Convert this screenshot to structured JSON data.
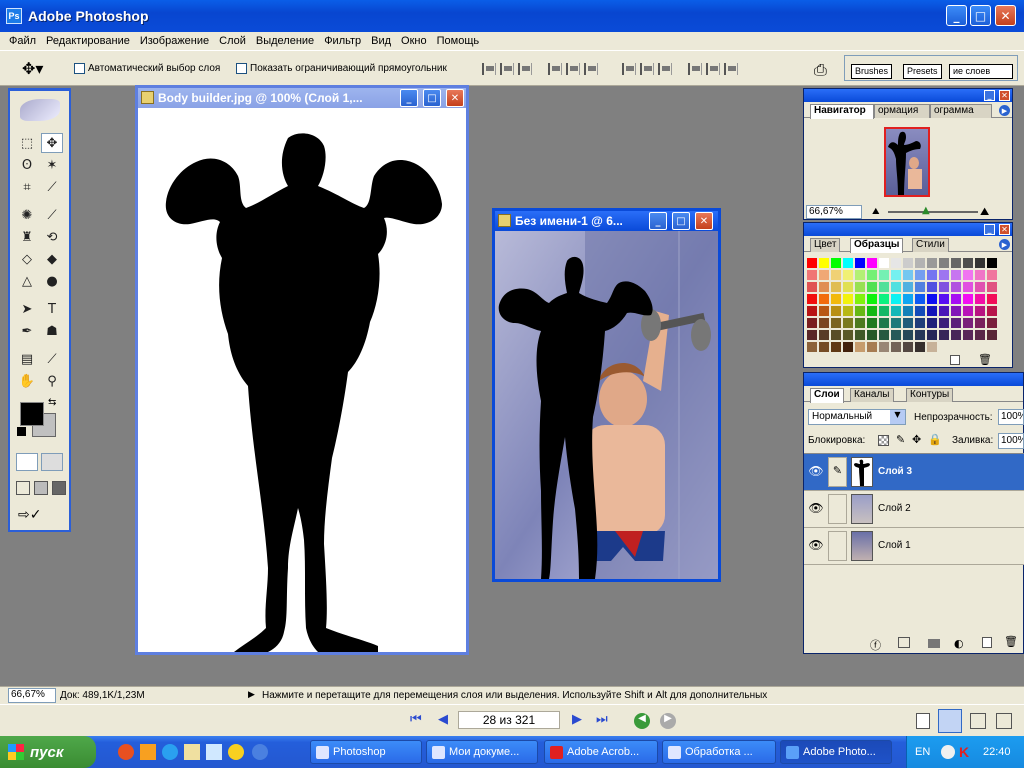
{
  "window": {
    "title": "Adobe Photoshop",
    "app_icon_text": "Ps"
  },
  "menu": [
    "Файл",
    "Редактирование",
    "Изображение",
    "Слой",
    "Выделение",
    "Фильтр",
    "Вид",
    "Окно",
    "Помощь"
  ],
  "options": {
    "auto_select_label": "Автоматический выбор слоя",
    "show_bbox_label": "Показать ограничивающий прямоугольник",
    "well_tabs": [
      "Brushes",
      "Presets",
      "ие слоев"
    ]
  },
  "doc1": {
    "title": "Body builder.jpg @ 100% (Слой 1,..."
  },
  "doc2": {
    "title": "Без имени-1 @ 6..."
  },
  "navigator": {
    "tabs": [
      "Навигатор",
      "ормация",
      "ограмма"
    ],
    "zoom": "66,67%"
  },
  "swatches": {
    "tabs": [
      "Цвет",
      "Образцы",
      "Стили"
    ]
  },
  "layers": {
    "tabs": [
      "Слои",
      "Каналы",
      "Контуры"
    ],
    "blend_mode": "Нормальный",
    "opacity_label": "Непрозрачность:",
    "opacity_value": "100%",
    "lock_label": "Блокировка:",
    "fill_label": "Заливка:",
    "fill_value": "100%",
    "items": [
      {
        "name": "Слой 3",
        "selected": true
      },
      {
        "name": "Слой 2",
        "selected": false
      },
      {
        "name": "Слой 1",
        "selected": false
      }
    ]
  },
  "status": {
    "zoom": "66,67%",
    "doc_info": "Док: 489,1K/1,23M",
    "hint": "Нажмите и перетащите для перемещения слоя или выделения. Используйте Shift и Alt для дополнительных"
  },
  "viewer": {
    "page_indicator": "28 из 321"
  },
  "taskbar": {
    "start_label": "пуск",
    "tasks": [
      "Photoshop",
      "Мои докуме...",
      "Adobe Acrob...",
      "Обработка ...",
      "Adobe Photo..."
    ],
    "lang": "EN",
    "clock": "22:40"
  },
  "colors": {
    "xp_blue": "#0a4ad8",
    "selected_layer": "#3169c6",
    "panel_bg": "#ece9d8",
    "canvas_bg": "#808080"
  }
}
